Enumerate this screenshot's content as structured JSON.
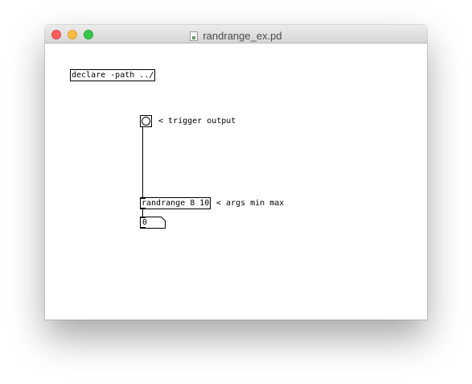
{
  "window": {
    "title": "randrange_ex.pd",
    "file_icon": "pd-document-icon"
  },
  "patch": {
    "declare_object": "declare -path ../",
    "bang_comment": "< trigger output",
    "randrange_object": "randrange 8 10",
    "randrange_comment": "< args min max",
    "number_value": "0"
  }
}
